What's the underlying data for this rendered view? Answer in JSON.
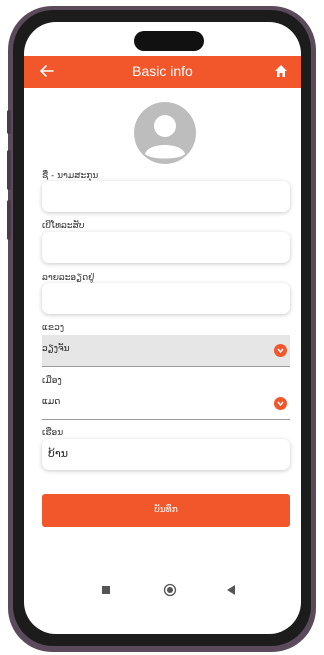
{
  "appbar": {
    "title": "Basic info",
    "back_icon": "arrow-left-icon",
    "home_icon": "home-icon",
    "color": "#f2562b"
  },
  "form": {
    "name_label": "ຊື່ - ນາມສະກຸນ",
    "name_value": "",
    "phone_label": "ເບີໂທລະສັບ",
    "phone_value": "",
    "address_label": "ລາຍລະອຽດຢູ່",
    "address_value": "",
    "province_label": "ແຂວງ",
    "province_value": "ວຽງຈັນ",
    "district_label": "ເມືອງ",
    "district_value": "ແມດ",
    "village_label": "ເຮືອນ",
    "village_value": "ບ້ານ"
  },
  "save_label": "ບັນທຶກ",
  "navbar": {
    "icons": [
      "square-icon",
      "circle-icon",
      "triangle-back-icon"
    ]
  }
}
